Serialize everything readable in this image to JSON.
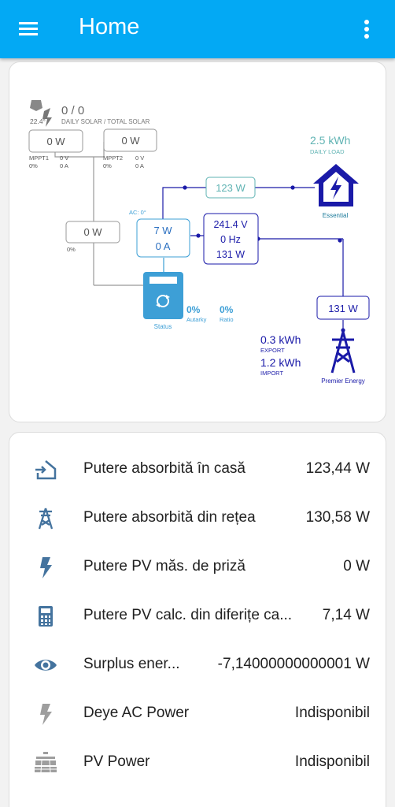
{
  "header": {
    "title": "Home"
  },
  "flow": {
    "solar_ratio": "0 / 0",
    "solar_sub": "DAILY SOLAR / TOTAL SOLAR",
    "angle": "22.4°",
    "mppt1": {
      "power": "0 W",
      "name": "MPPT1",
      "volt": "0 V",
      "pct": "0%",
      "amp": "0 A"
    },
    "mppt2": {
      "power": "0 W",
      "name": "MPPT2",
      "volt": "0 V",
      "pct": "0%",
      "amp": "0 A"
    },
    "daily_load_value": "2.5 kWh",
    "daily_load_label": "DAILY LOAD",
    "load_power": "123 W",
    "essential_label": "Essential",
    "ac_label": "AC: 0°",
    "inverter_power": "7 W",
    "inverter_current": "0 A",
    "aux_power": "0 W",
    "aux_pct": "0%",
    "grid_voltage": "241.4 V",
    "grid_freq": "0 Hz",
    "grid_power_box": "131 W",
    "grid_power": "131 W",
    "status_label": "Status",
    "autarky_value": "0%",
    "autarky_label": "Autarky",
    "ratio_value": "0%",
    "ratio_label": "Ratio",
    "export_value": "0.3 kWh",
    "export_label": "EXPORT",
    "import_value": "1.2 kWh",
    "import_label": "IMPORT",
    "grid_label": "Premier Energy"
  },
  "entities": [
    {
      "icon": "home-import-icon",
      "label": "Putere absorbită în casă",
      "value": "123,44 W"
    },
    {
      "icon": "transmission-tower-icon",
      "label": "Putere absorbită din rețea",
      "value": "130,58 W"
    },
    {
      "icon": "flash-icon",
      "label": "Putere PV măs. de priză",
      "value": "0 W"
    },
    {
      "icon": "calculator-icon",
      "label": "Putere PV calc. din diferițe ca...",
      "value": "7,14 W"
    },
    {
      "icon": "eye-icon",
      "label": "Surplus ener...",
      "value": "-7,14000000000001 W"
    },
    {
      "icon": "flash-icon",
      "label": "Deye AC Power",
      "value": "Indisponibil"
    },
    {
      "icon": "solar-panel-icon",
      "label": "PV Power",
      "value": "Indisponibil"
    }
  ],
  "colors": {
    "appbar": "#03a9f4",
    "grid_blue": "#1a1aa8",
    "load_teal": "#5fb3b3",
    "inverter_blue": "#3d9fd6",
    "icon_blue": "#44739e"
  }
}
